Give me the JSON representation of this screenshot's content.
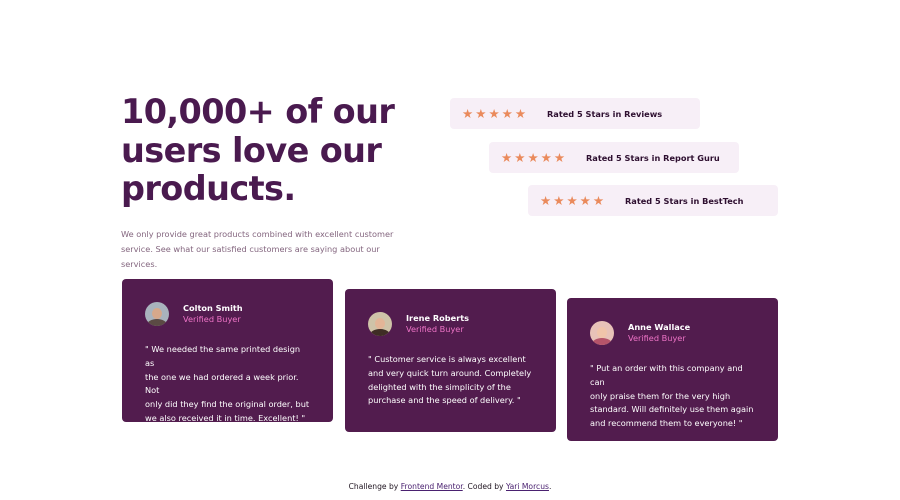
{
  "hero": {
    "headline_lines": [
      "10,000+ of our",
      "users love our",
      "products."
    ],
    "intro_lines": [
      "We only provide great products combined with excellent customer",
      "service. See what our satisfied customers are saying about our services."
    ]
  },
  "ratings": [
    {
      "stars": 5,
      "label": "Rated 5 Stars in Reviews"
    },
    {
      "stars": 5,
      "label": "Rated 5 Stars in Report Guru"
    },
    {
      "stars": 5,
      "label": "Rated 5 Stars in BestTech"
    }
  ],
  "star_icon": "star-icon",
  "testimonials": [
    {
      "name": "Colton Smith",
      "status": "Verified Buyer",
      "avatar_icon": "avatar-colton-smith",
      "quote_lines": [
        "\" We needed the same printed design as",
        "the one we had ordered a week prior. Not",
        "only did they find the original order, but",
        "we also received it in time. Excellent! \""
      ]
    },
    {
      "name": "Irene Roberts",
      "status": "Verified Buyer",
      "avatar_icon": "avatar-irene-roberts",
      "quote_lines": [
        "\" Customer service is always excellent",
        "and very quick turn around. Completely",
        "delighted with the simplicity of the",
        "purchase and the speed of delivery. \""
      ]
    },
    {
      "name": "Anne Wallace",
      "status": "Verified Buyer",
      "avatar_icon": "avatar-anne-wallace",
      "quote_lines": [
        "\" Put an order with this company and can",
        "only praise them for the very high",
        "standard. Will definitely use them again",
        "and recommend them to everyone! \""
      ]
    }
  ],
  "footer": {
    "prefix": "Challenge by",
    "link1": "Frontend Mentor",
    "middle": ". Coded by",
    "link2": "Yari Morcus",
    "suffix": "."
  },
  "colors": {
    "heading": "#4a1a4f",
    "card_bg": "#521c4e",
    "rating_bg": "#f7eff7",
    "star": "#ea8a5c",
    "verified": "#ee74c7"
  }
}
